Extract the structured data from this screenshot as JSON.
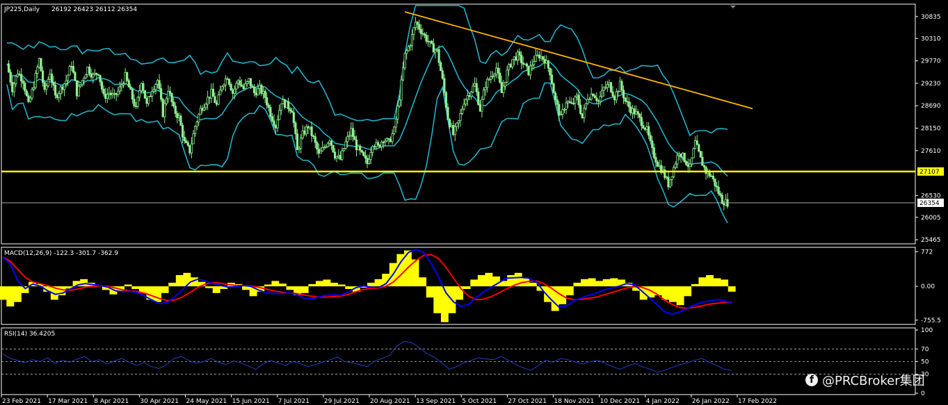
{
  "chart_data": [
    {
      "type": "candlestick",
      "title": "JP225,Daily",
      "ohlc_label": "26192 26423 26112 26354",
      "open": 26192,
      "high": 26423,
      "low": 26112,
      "close": 26354,
      "yaxis_ticks": [
        30835,
        30310,
        29770,
        29230,
        28690,
        28150,
        27610,
        26530,
        26005,
        25465
      ],
      "ylim": [
        25400,
        31100
      ],
      "horizontal_level": {
        "value": 27107,
        "label": "27107",
        "color": "#FFFF00"
      },
      "last_price": {
        "value": 26354,
        "label": "26354"
      },
      "trendline": {
        "color": "#FFB800",
        "from": {
          "date": "10 Sep 2021",
          "value": 30950
        },
        "to": {
          "date": "25 Feb 2022",
          "value": 28620
        }
      },
      "series_colors": {
        "candles": "#90EE90",
        "bollinger": "#20B2C8",
        "grid": "none"
      },
      "close_path": [
        29700,
        29100,
        29500,
        29300,
        28700,
        29200,
        29800,
        29000,
        29500,
        28900,
        29100,
        29300,
        29700,
        29000,
        29300,
        29600,
        29400,
        29500,
        28900,
        29000,
        28900,
        29100,
        29400,
        29000,
        28600,
        29300,
        28700,
        29100,
        29300,
        28500,
        29100,
        28600,
        28400,
        27800,
        27600,
        28200,
        28600,
        28800,
        29000,
        28700,
        29200,
        29400,
        29000,
        29300,
        29100,
        29300,
        29000,
        29100,
        28900,
        28500,
        28200,
        28800,
        28700,
        28600,
        27600,
        28000,
        28200,
        27900,
        27500,
        27700,
        27900,
        27500,
        27400,
        27800,
        28100,
        27700,
        27500,
        27300,
        27800,
        27700,
        27900,
        27800,
        28100,
        28900,
        29900,
        30200,
        30700,
        30500,
        30300,
        30100,
        30000,
        29300,
        28400,
        28000,
        28300,
        28800,
        29000,
        29200,
        28600,
        29200,
        29400,
        29600,
        29000,
        29500,
        29800,
        29900,
        29700,
        29500,
        29800,
        29900,
        29800,
        29500,
        28800,
        28400,
        28800,
        28700,
        28900,
        28400,
        28900,
        29000,
        28800,
        29100,
        29200,
        28900,
        29200,
        28800,
        28600,
        28500,
        28300,
        28100,
        27600,
        27300,
        27100,
        26800,
        27200,
        27600,
        27400,
        27200,
        27800,
        27400,
        27100,
        27000,
        26700,
        26400,
        26354
      ]
    },
    {
      "type": "line",
      "title": "MACD(12,26,9) -122.3 -301.7 -362.9",
      "yaxis_ticks": [
        "772",
        "0.00",
        "-755.5"
      ],
      "ylim": [
        -820,
        840
      ],
      "series_colors": {
        "histogram": "#FFFF00",
        "macd": "#0000FF",
        "signal": "#FF0000"
      },
      "histogram": [
        -300,
        -450,
        -350,
        -150,
        100,
        50,
        -120,
        -300,
        -200,
        -50,
        120,
        160,
        80,
        30,
        -80,
        -180,
        -100,
        40,
        -60,
        -150,
        -300,
        -350,
        -150,
        80,
        250,
        300,
        200,
        100,
        -40,
        -150,
        -60,
        80,
        50,
        -80,
        -220,
        -120,
        40,
        120,
        60,
        -80,
        -200,
        -150,
        50,
        120,
        150,
        80,
        40,
        -60,
        -120,
        -30,
        80,
        160,
        280,
        520,
        720,
        800,
        600,
        200,
        -250,
        -600,
        -800,
        -600,
        -300,
        -60,
        150,
        250,
        300,
        220,
        120,
        250,
        300,
        180,
        80,
        -100,
        -350,
        -550,
        -400,
        -200,
        80,
        160,
        180,
        120,
        160,
        180,
        150,
        80,
        -100,
        -300,
        -250,
        -200,
        -300,
        -350,
        -420,
        -220,
        50,
        200,
        250,
        180,
        150,
        -120
      ],
      "macd": [
        650,
        500,
        120,
        -50,
        50,
        0,
        -100,
        -180,
        -150,
        -60,
        30,
        60,
        40,
        20,
        -20,
        -100,
        -120,
        -110,
        -150,
        -230,
        -320,
        -390,
        -350,
        -220,
        -60,
        100,
        160,
        120,
        60,
        20,
        -20,
        -10,
        20,
        0,
        -80,
        -140,
        -160,
        -160,
        -150,
        -180,
        -260,
        -280,
        -240,
        -200,
        -190,
        -200,
        -120,
        -30,
        10,
        -20,
        -30,
        60,
        280,
        550,
        760,
        820,
        760,
        520,
        200,
        -150,
        -350,
        -450,
        -400,
        -250,
        -120,
        -20,
        80,
        180,
        190,
        200,
        180,
        100,
        -120,
        -300,
        -460,
        -440,
        -320,
        -260,
        -200,
        -150,
        -80,
        -40,
        0,
        60,
        40,
        -100,
        -250,
        -400,
        -560,
        -620,
        -580,
        -500,
        -420,
        -360,
        -330,
        -300,
        -320,
        -380
      ],
      "signal": [
        650,
        560,
        380,
        200,
        100,
        60,
        20,
        -40,
        -80,
        -90,
        -60,
        -20,
        0,
        10,
        0,
        -40,
        -80,
        -100,
        -120,
        -160,
        -220,
        -280,
        -320,
        -300,
        -230,
        -130,
        -20,
        50,
        80,
        70,
        40,
        20,
        20,
        10,
        -20,
        -60,
        -100,
        -130,
        -150,
        -160,
        -190,
        -220,
        -240,
        -240,
        -230,
        -220,
        -180,
        -120,
        -70,
        -50,
        -40,
        0,
        100,
        260,
        430,
        580,
        690,
        710,
        620,
        420,
        180,
        -60,
        -220,
        -300,
        -290,
        -230,
        -150,
        -60,
        20,
        80,
        110,
        120,
        60,
        -40,
        -160,
        -260,
        -300,
        -290,
        -270,
        -240,
        -190,
        -140,
        -90,
        -40,
        -10,
        -20,
        -80,
        -170,
        -300,
        -400,
        -470,
        -490,
        -470,
        -440,
        -400,
        -380,
        -360,
        -360
      ]
    },
    {
      "type": "line",
      "title": "RSI(14) 36.4205",
      "yaxis_ticks": [
        "100",
        "70",
        "50",
        "30",
        "0"
      ],
      "ylim": [
        0,
        100
      ],
      "levels": [
        70,
        50,
        30
      ],
      "series_colors": {
        "rsi": "#2040C0",
        "levels": "#C0C0C0"
      },
      "values": [
        62,
        55,
        52,
        48,
        53,
        50,
        56,
        47,
        52,
        49,
        54,
        58,
        50,
        53,
        46,
        51,
        55,
        49,
        44,
        48,
        42,
        39,
        45,
        55,
        58,
        52,
        47,
        50,
        55,
        49,
        45,
        51,
        48,
        43,
        38,
        46,
        52,
        48,
        44,
        50,
        47,
        42,
        45,
        49,
        53,
        57,
        50,
        48,
        45,
        42,
        51,
        55,
        60,
        75,
        82,
        80,
        72,
        63,
        57,
        48,
        38,
        42,
        48,
        52,
        56,
        54,
        53,
        58,
        52,
        45,
        40,
        36,
        44,
        52,
        49,
        55,
        53,
        49,
        46,
        50,
        52,
        47,
        42,
        38,
        43,
        47,
        42,
        38,
        33,
        36,
        41,
        45,
        48,
        52,
        55,
        49,
        44,
        38,
        36
      ]
    },
    {
      "type": "axis",
      "x_tick_labels": [
        "23 Feb 2021",
        "17 Mar 2021",
        "8 Apr 2021",
        "30 Apr 2021",
        "24 May 2021",
        "15 Jun 2021",
        "7 Jul 2021",
        "29 Jul 2021",
        "20 Aug 2021",
        "13 Sep 2021",
        "5 Oct 2021",
        "27 Oct 2021",
        "18 Nov 2021",
        "10 Dec 2021",
        "4 Jan 2022",
        "26 Jan 2022",
        "17 Feb 2022"
      ]
    }
  ],
  "watermark": {
    "text": "@PRCBroker集团",
    "icon": "facebook-icon"
  }
}
